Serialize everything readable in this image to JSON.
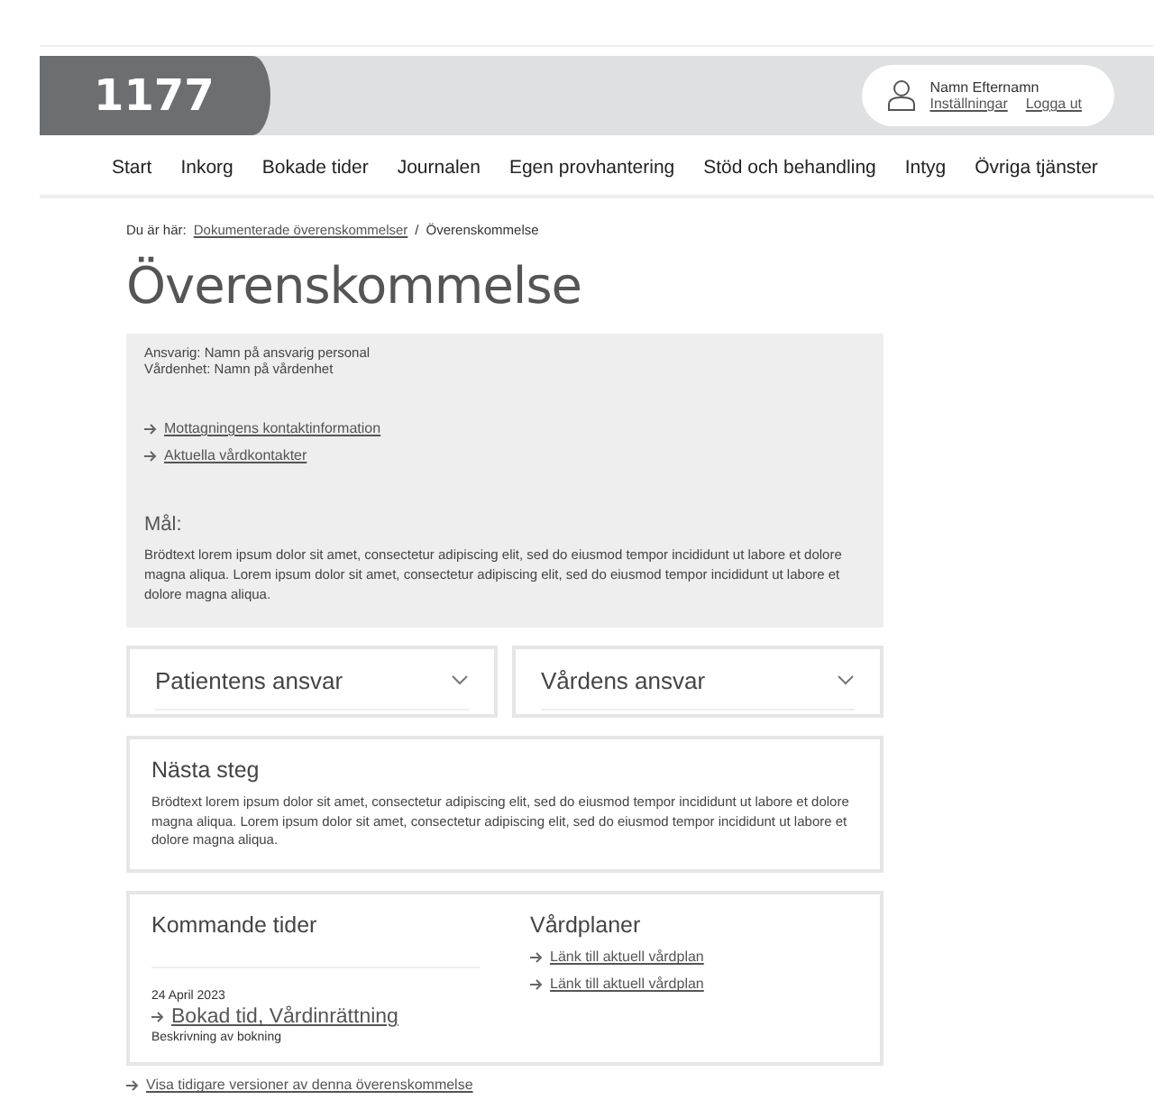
{
  "header": {
    "logo": "1177",
    "user": {
      "name": "Namn Efternamn",
      "links": [
        "Inställningar",
        "Logga ut"
      ]
    }
  },
  "nav": [
    "Start",
    "Inkorg",
    "Bokade tider",
    "Journalen",
    "Egen provhantering",
    "Stöd och behandling",
    "Intyg",
    "Övriga tjänster"
  ],
  "breadcrumb": {
    "label": "Du är här:",
    "separator": "/",
    "items": [
      "Dokumenterade överenskommelser",
      "Överenskommelse"
    ]
  },
  "title": "Överenskommelse",
  "summary": {
    "lines": [
      "Ansvarig: Namn på ansvarig personal",
      "Vårdenhet: Namn på vårdenhet"
    ],
    "links": [
      "Mottagningens kontaktinformation",
      "Aktuella vårdkontakter"
    ],
    "goal_heading": "Mål:",
    "goal_text": "Brödtext lorem ipsum dolor sit amet, consectetur adipiscing elit, sed do eiusmod tempor incididunt ut labore et dolore magna aliqua. Lorem ipsum dolor sit amet, consectetur adipiscing elit, sed do eiusmod tempor incididunt ut labore et dolore magna aliqua."
  },
  "accordions": [
    {
      "label": "Patientens ansvar",
      "expanded": false
    },
    {
      "label": "Vårdens ansvar",
      "expanded": false
    }
  ],
  "next_step": {
    "heading": "Nästa steg",
    "text": "Brödtext lorem ipsum dolor sit amet, consectetur adipiscing elit, sed do eiusmod tempor incididunt ut labore et dolore magna aliqua. Lorem ipsum dolor sit amet, consectetur adipiscing elit, sed do eiusmod tempor incididunt ut labore et dolore magna aliqua."
  },
  "appointments": {
    "heading": "Kommande tider",
    "date": "24 April 2023",
    "link": "Bokad tid, Vårdinrättning",
    "description": "Beskrivning av bokning"
  },
  "care_plans": {
    "heading": "Vårdplaner",
    "links": [
      "Länk till aktuell vårdplan",
      "Länk till aktuell vårdplan"
    ]
  },
  "footer_link": "Visa tidigare versioner av denna överenskommelse"
}
